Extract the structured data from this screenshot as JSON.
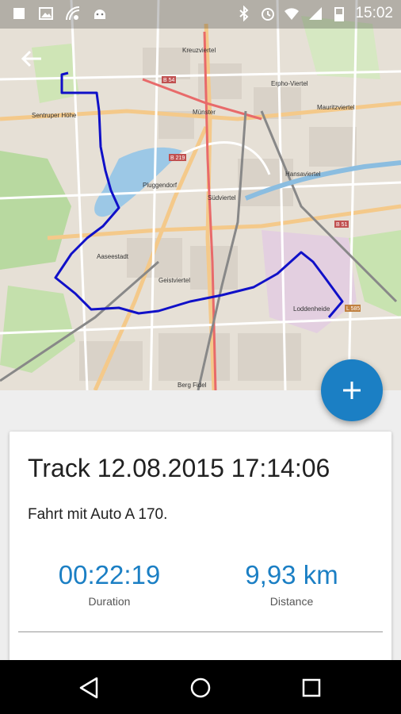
{
  "status_bar": {
    "time": "15:02"
  },
  "map": {
    "labels": [
      "Kreuzviertel",
      "Münster",
      "Pluggendorf",
      "Südviertel",
      "Aaseestadt",
      "Geistviertel",
      "Mauritzviertel",
      "Loddenheide",
      "Sentruper Höhe",
      "Berg Fidel",
      "Hansaviertel",
      "Erpho-Viertel"
    ],
    "road_labels": [
      "B 54",
      "B 219",
      "B 51",
      "L 585"
    ],
    "route_color": "#1010c8"
  },
  "actions": {
    "add_label": "+"
  },
  "track": {
    "title": "Track 12.08.2015 17:14:06",
    "description": "Fahrt mit Auto A 170.",
    "duration": {
      "value": "00:22:19",
      "label": "Duration"
    },
    "distance": {
      "value": "9,93 km",
      "label": "Distance"
    }
  },
  "accent_color": "#1b7fc4"
}
